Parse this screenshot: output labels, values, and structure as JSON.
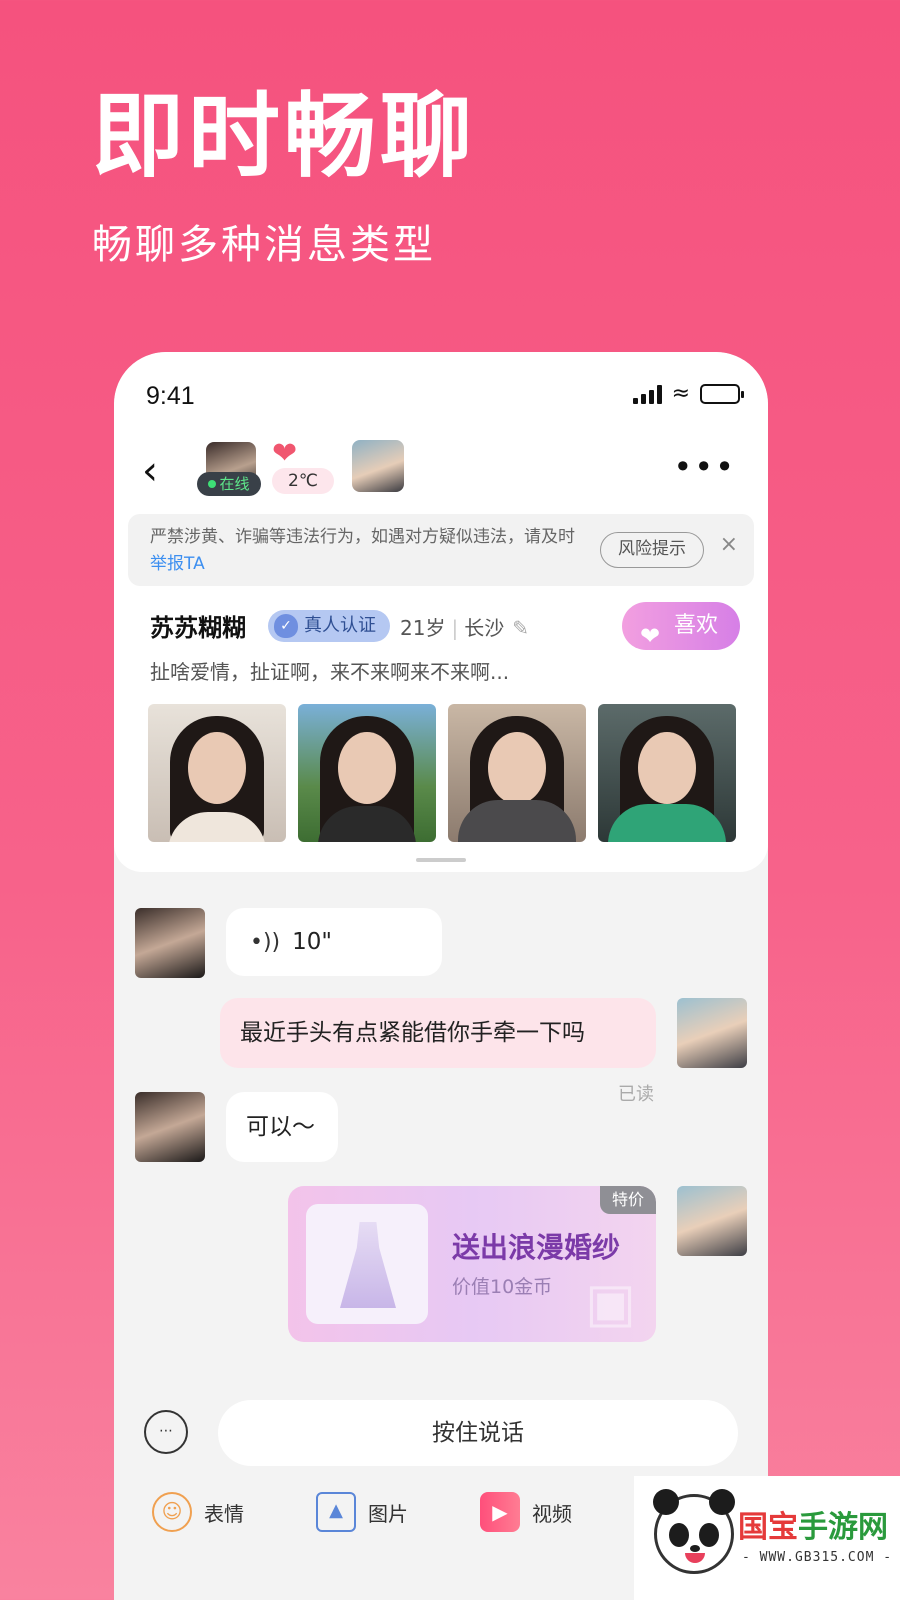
{
  "hero": {
    "title": "即时畅聊",
    "subtitle": "畅聊多种消息类型"
  },
  "status_bar": {
    "time": "9:41"
  },
  "chat_header": {
    "online_label": "在线",
    "temperature": "2℃",
    "more_icon": "more-icon"
  },
  "warning": {
    "text_part1": "严禁涉黄、诈骗等违法行为，如遇对方疑似违法，请及时",
    "link_text": "举报TA",
    "risk_button": "风险提示",
    "close_icon": "×"
  },
  "profile": {
    "name": "苏苏糊糊",
    "verify_label": "真人认证",
    "age": "21岁",
    "city": "长沙",
    "like_label": "喜欢",
    "signature": "扯啥爱情，扯证啊，来不来啊来不来啊..."
  },
  "messages": {
    "voice_duration": "10\"",
    "outgoing_text": "最近手头有点紧能借你手牵一下吗",
    "read_status": "已读",
    "incoming_text": "可以～"
  },
  "gift": {
    "title": "送出浪漫婚纱",
    "price": "价值10金币",
    "badge": "特价"
  },
  "input": {
    "hold_to_talk": "按住说话"
  },
  "toolbar": {
    "items": [
      {
        "label": "表情",
        "icon": "emoji-icon"
      },
      {
        "label": "图片",
        "icon": "image-icon"
      },
      {
        "label": "视频",
        "icon": "video-icon"
      }
    ]
  },
  "watermark": {
    "name_red": "国宝",
    "name_green": "手游网",
    "url": "- WWW.GB315.COM -"
  },
  "colors": {
    "brand_pink": "#f5527e",
    "like_gradient": "#d67fe6",
    "online_green": "#3edf76",
    "link_blue": "#3d8ff0"
  }
}
